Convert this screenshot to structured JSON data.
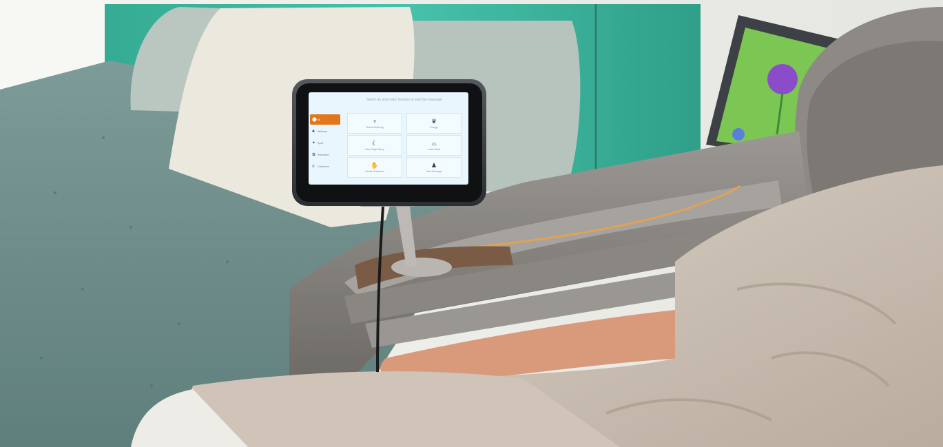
{
  "screen": {
    "title": "Select an automatic function to start the massage",
    "menu": [
      {
        "label": "All",
        "icon": "chair-icon",
        "active": true
      },
      {
        "label": "Wellness",
        "icon": "leaf-icon",
        "active": false
      },
      {
        "label": "Sport",
        "icon": "runner-icon",
        "active": false
      },
      {
        "label": "Relaxation",
        "icon": "lotus-icon",
        "active": false
      },
      {
        "label": "Customize",
        "icon": "sliders-icon",
        "active": false
      }
    ],
    "programs": [
      {
        "label": "Stress Relieving",
        "icon": "person-stretch-icon"
      },
      {
        "label": "Energy",
        "icon": "energy-person-icon"
      },
      {
        "label": "Good Night Sleep",
        "icon": "moon-icon"
      },
      {
        "label": "Lower Back",
        "icon": "lying-person-icon"
      },
      {
        "label": "Gentle Relaxation",
        "icon": "hands-icon"
      },
      {
        "label": "Neck Massage",
        "icon": "neck-icon"
      }
    ]
  },
  "colors": {
    "accent": "#e2761b",
    "screen_bg": "#e9f6fd",
    "headboard": "#3fb8a0",
    "bedspread": "#6f8f8c",
    "chair": "#8c8985"
  }
}
